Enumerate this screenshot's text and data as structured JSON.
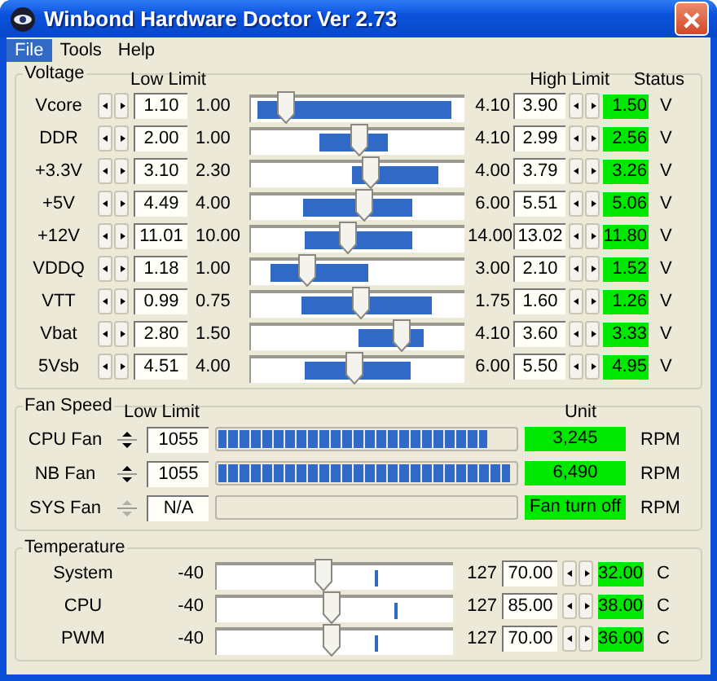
{
  "window": {
    "title": "Winbond Hardware Doctor Ver 2.73"
  },
  "menu": [
    {
      "label": "File",
      "selected": true
    },
    {
      "label": "Tools",
      "selected": false
    },
    {
      "label": "Help",
      "selected": false
    }
  ],
  "voltage": {
    "title": "Voltage",
    "low_header": "Low Limit",
    "high_header": "High Limit",
    "status_header": "Status",
    "rows": [
      {
        "name": "Vcore",
        "low_limit": "1.10",
        "min": "1.00",
        "level": 0.16,
        "max": "4.10",
        "high_limit": "3.90",
        "status": "1.50",
        "unit": "V"
      },
      {
        "name": "DDR",
        "low_limit": "2.00",
        "min": "1.00",
        "level": 0.5,
        "max": "4.10",
        "high_limit": "2.99",
        "status": "2.56",
        "unit": "V"
      },
      {
        "name": "+3.3V",
        "low_limit": "3.10",
        "min": "2.30",
        "level": 0.56,
        "max": "4.00",
        "high_limit": "3.79",
        "status": "3.26",
        "unit": "V"
      },
      {
        "name": "+5V",
        "low_limit": "4.49",
        "min": "4.00",
        "level": 0.53,
        "max": "6.00",
        "high_limit": "5.51",
        "status": "5.06",
        "unit": "V"
      },
      {
        "name": "+12V",
        "low_limit": "11.01",
        "min": "10.00",
        "level": 0.45,
        "max": "14.00",
        "high_limit": "13.02",
        "status": "11.80",
        "unit": "V"
      },
      {
        "name": "VDDQ",
        "low_limit": "1.18",
        "min": "1.00",
        "level": 0.26,
        "max": "3.00",
        "high_limit": "2.10",
        "status": "1.52",
        "unit": "V"
      },
      {
        "name": "VTT",
        "low_limit": "0.99",
        "min": "0.75",
        "level": 0.51,
        "max": "1.75",
        "high_limit": "1.60",
        "status": "1.26",
        "unit": "V"
      },
      {
        "name": "Vbat",
        "low_limit": "2.80",
        "min": "1.50",
        "level": 0.7,
        "max": "4.10",
        "high_limit": "3.60",
        "status": "3.33",
        "unit": "V"
      },
      {
        "name": "5Vsb",
        "low_limit": "4.51",
        "min": "4.00",
        "level": 0.48,
        "max": "6.00",
        "high_limit": "5.50",
        "status": "4.95",
        "unit": "V"
      }
    ]
  },
  "fan_speed": {
    "title": "Fan Speed",
    "low_header": "Low Limit",
    "unit_header": "Unit",
    "rows": [
      {
        "name": "CPU Fan",
        "low_limit": "1055",
        "level": 0.9,
        "status": "3,245",
        "unit": "RPM",
        "disabled": false
      },
      {
        "name": "NB Fan",
        "low_limit": "1055",
        "level": 0.98,
        "status": "6,490",
        "unit": "RPM",
        "disabled": false
      },
      {
        "name": "SYS Fan",
        "low_limit": "N/A",
        "status": "Fan turn off",
        "unit": "RPM",
        "disabled": true
      }
    ]
  },
  "temperature": {
    "title": "Temperature",
    "rows": [
      {
        "name": "System",
        "min": "-40",
        "limit_slider": {
          "level": 0.45
        },
        "reading_marker": {
          "level": 0.67
        },
        "max": "127",
        "high_limit": "70.00",
        "status": "32.00",
        "unit": "C"
      },
      {
        "name": "CPU",
        "min": "-40",
        "limit_slider": {
          "level": 0.48
        },
        "reading_marker": {
          "level": 0.75
        },
        "max": "127",
        "high_limit": "85.00",
        "status": "38.00",
        "unit": "C"
      },
      {
        "name": "PWM",
        "min": "-40",
        "limit_slider": {
          "level": 0.48
        },
        "reading_marker": {
          "level": 0.67
        },
        "max": "127",
        "high_limit": "70.00",
        "status": "36.00",
        "unit": "C"
      }
    ]
  }
}
